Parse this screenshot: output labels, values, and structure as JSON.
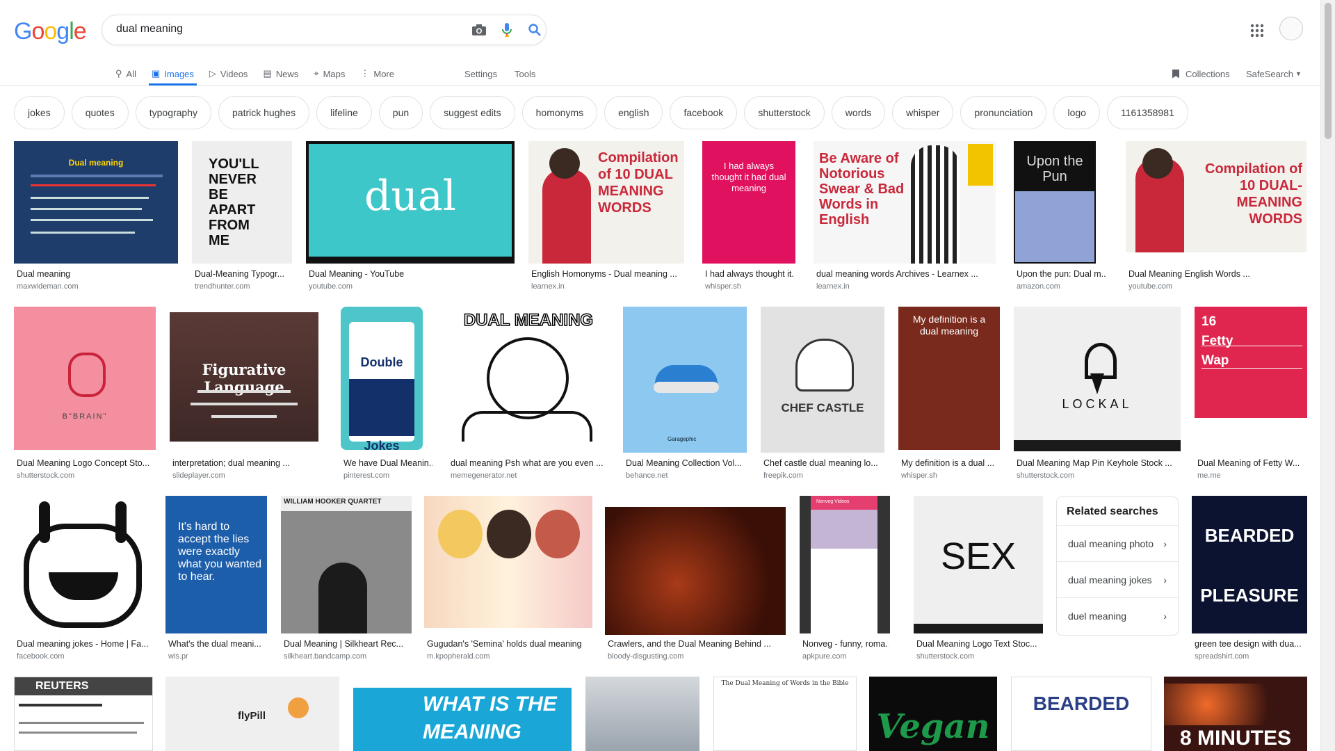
{
  "search": {
    "query": "dual meaning"
  },
  "tabs": [
    {
      "label": "All",
      "icon": "search-icon"
    },
    {
      "label": "Images",
      "icon": "image-icon"
    },
    {
      "label": "Videos",
      "icon": "video-icon"
    },
    {
      "label": "News",
      "icon": "news-icon"
    },
    {
      "label": "Maps",
      "icon": "map-icon"
    },
    {
      "label": "More",
      "icon": "more-icon"
    }
  ],
  "tools": {
    "settings": "Settings",
    "tools": "Tools",
    "collections": "Collections",
    "safesearch": "SafeSearch"
  },
  "chips": [
    "jokes",
    "quotes",
    "typography",
    "patrick hughes",
    "lifeline",
    "pun",
    "suggest edits",
    "homonyms",
    "english",
    "facebook",
    "shutterstock",
    "words",
    "whisper",
    "pronunciation",
    "logo",
    "1161358981"
  ],
  "results": [
    {
      "title": "Dual meaning",
      "source": "maxwideman.com",
      "img_text": "Dual meaning"
    },
    {
      "title": "Dual-Meaning Typogr...",
      "source": "trendhunter.com",
      "img_text": "YOU'LL NEVER BE APART FROM ME"
    },
    {
      "title": "Dual Meaning - YouTube",
      "source": "youtube.com",
      "img_text": "dual"
    },
    {
      "title": "English Homonyms - Dual meaning ...",
      "source": "learnex.in",
      "img_text": "Compilation of 10 DUAL MEANING WORDS"
    },
    {
      "title": "I had always thought it...",
      "source": "whisper.sh",
      "img_text": "I had always thought it had dual meaning"
    },
    {
      "title": "dual meaning words Archives - Learnex ...",
      "source": "learnex.in",
      "img_text": "Be Aware of Notorious Swear & Bad Words in English"
    },
    {
      "title": "Upon the pun: Dual m...",
      "source": "amazon.com",
      "img_text": "Upon the Pun"
    },
    {
      "title": "Dual Meaning English Words ...",
      "source": "youtube.com",
      "img_text": "Compilation of 10 DUAL-MEANING WORDS"
    },
    {
      "title": "Dual Meaning Logo Concept Sto...",
      "source": "shutterstock.com",
      "img_text": "B\"BRAIN\""
    },
    {
      "title": "interpretation; dual meaning ...",
      "source": "slideplayer.com",
      "img_text": "Figurative Language"
    },
    {
      "title": "We have Dual Meanin...",
      "source": "pinterest.com",
      "img_text": "Double Meaning Funny Jokes"
    },
    {
      "title": "dual meaning Psh what are you even ...",
      "source": "memegenerator.net",
      "img_text": "DUAL MEANING"
    },
    {
      "title": "Dual Meaning Collection Vol...",
      "source": "behance.net",
      "img_text": "Garagephic"
    },
    {
      "title": "Chef castle dual meaning lo...",
      "source": "freepik.com",
      "img_text": "CHEF CASTLE"
    },
    {
      "title": "My definition is a dual ...",
      "source": "whisper.sh",
      "img_text": "My definition is a dual meaning"
    },
    {
      "title": "Dual Meaning Map Pin Keyhole Stock ...",
      "source": "shutterstock.com",
      "img_text": "LOCKAL"
    },
    {
      "title": "Dual Meaning of Fetty W...",
      "source": "me.me",
      "img_text": "16 Fetty Wap"
    },
    {
      "title": "Dual meaning jokes - Home | Fa...",
      "source": "facebook.com",
      "img_text": ""
    },
    {
      "title": "What's the dual meani...",
      "source": "wis.pr",
      "img_text": "It's hard to accept the lies were exactly what you wanted to hear."
    },
    {
      "title": "Dual Meaning | Silkheart Rec...",
      "source": "silkheart.bandcamp.com",
      "img_text": "WILLIAM HOOKER QUARTET"
    },
    {
      "title": "Gugudan's 'Semina' holds dual meaning",
      "source": "m.kpopherald.com",
      "img_text": ""
    },
    {
      "title": "Crawlers, and the Dual Meaning Behind ...",
      "source": "bloody-disgusting.com",
      "img_text": ""
    },
    {
      "title": "Nonveg - funny, roma...",
      "source": "apkpure.com",
      "img_text": "Nonveg Videos"
    },
    {
      "title": "Dual Meaning Logo Text Stoc...",
      "source": "shutterstock.com",
      "img_text": "SEX"
    },
    {
      "title": "green tee design with dua...",
      "source": "spreadshirt.com",
      "img_text": "BEARDED PLEASURE"
    },
    {
      "title": "",
      "source": "",
      "img_text": "REUTERS"
    },
    {
      "title": "",
      "source": "",
      "img_text": "flyPill"
    },
    {
      "title": "",
      "source": "",
      "img_text": "WHAT IS THE MEANING"
    },
    {
      "title": "",
      "source": "",
      "img_text": ""
    },
    {
      "title": "",
      "source": "",
      "img_text": "The Dual Meaning of Words in the Bible"
    },
    {
      "title": "",
      "source": "",
      "img_text": "Vegan"
    },
    {
      "title": "",
      "source": "",
      "img_text": "BEARDED"
    },
    {
      "title": "",
      "source": "",
      "img_text": "8 MINUTES"
    }
  ],
  "related": {
    "title": "Related searches",
    "items": [
      "dual meaning photo",
      "dual meaning jokes",
      "duel meaning"
    ]
  }
}
